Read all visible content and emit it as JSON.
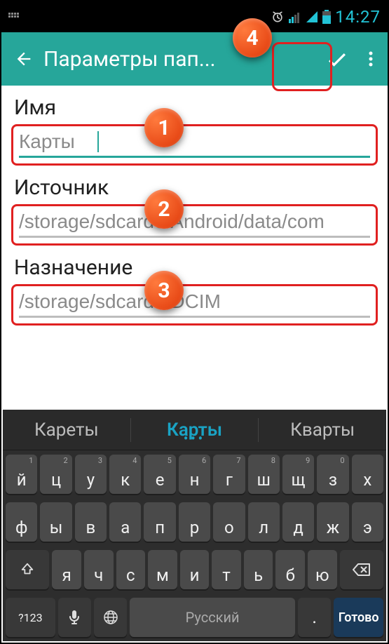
{
  "status": {
    "time": "14:27"
  },
  "appbar": {
    "title": "Параметры пап..."
  },
  "form": {
    "name_label": "Имя",
    "name_value": "Карты",
    "source_label": "Источник",
    "source_value": "/storage/sdcard0/Android/data/com",
    "dest_label": "Назначение",
    "dest_value": "/storage/sdcard1/DCIM"
  },
  "callouts": {
    "b1": "1",
    "b2": "2",
    "b3": "3",
    "b4": "4"
  },
  "keyboard": {
    "suggestions": [
      "Кареты",
      "Карты",
      "Кварты"
    ],
    "row1": [
      {
        "main": "й",
        "alt": "1"
      },
      {
        "main": "ц",
        "alt": "2"
      },
      {
        "main": "у",
        "alt": "3"
      },
      {
        "main": "к",
        "alt": "4"
      },
      {
        "main": "е",
        "alt": "5"
      },
      {
        "main": "н",
        "alt": "6"
      },
      {
        "main": "г",
        "alt": "7"
      },
      {
        "main": "ш",
        "alt": "8"
      },
      {
        "main": "щ",
        "alt": "9"
      },
      {
        "main": "з",
        "alt": "0"
      },
      {
        "main": "х",
        "alt": ""
      }
    ],
    "row2": [
      {
        "main": "ф"
      },
      {
        "main": "ы"
      },
      {
        "main": "в"
      },
      {
        "main": "а"
      },
      {
        "main": "п"
      },
      {
        "main": "р"
      },
      {
        "main": "о"
      },
      {
        "main": "л"
      },
      {
        "main": "д"
      },
      {
        "main": "ж"
      },
      {
        "main": "э"
      }
    ],
    "row3": [
      {
        "main": "я"
      },
      {
        "main": "ч"
      },
      {
        "main": "с"
      },
      {
        "main": "м"
      },
      {
        "main": "и"
      },
      {
        "main": "т"
      },
      {
        "main": "ь"
      },
      {
        "main": "б"
      },
      {
        "main": "ю"
      }
    ],
    "row4": {
      "symbols": "?123",
      "space": "Русский",
      "period": ".",
      "done": "Готово"
    }
  }
}
